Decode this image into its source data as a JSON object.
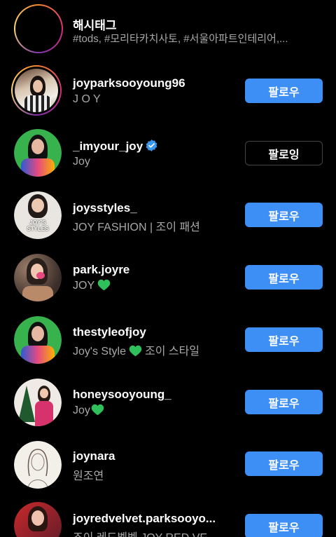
{
  "hashtag": {
    "title": "해시태그",
    "subtitle": "#tods, #모리타카치사토, #서울아파트인테리어,..."
  },
  "accounts": [
    {
      "username": "joyparksooyoung96",
      "subtitle": "J O Y",
      "button": "팔로우",
      "verified": false
    },
    {
      "username": "_imyour_joy",
      "subtitle": "Joy",
      "button": "팔로잉",
      "verified": true
    },
    {
      "username": "joysstyles_",
      "subtitle": "JOY FASHION | 조이 패션",
      "button": "팔로우",
      "verified": false,
      "avatar_text": "JOY'S STYLES"
    },
    {
      "username": "park.joyre",
      "subtitle": "JOY",
      "button": "팔로우",
      "verified": false,
      "heart": true
    },
    {
      "username": "thestyleofjoy",
      "subtitle_a": "Joy's Style",
      "subtitle_b": "조이 스타일",
      "button": "팔로우",
      "verified": false
    },
    {
      "username": "honeysooyoung_",
      "subtitle": "Joy",
      "button": "팔로우",
      "verified": false,
      "heart": true
    },
    {
      "username": "joynara",
      "subtitle": "원조연",
      "button": "팔로우",
      "verified": false
    },
    {
      "username": "joyredvelvet.parksooyo...",
      "subtitle": "조이 레드벨벳 JOY RED VE",
      "button": "팔로우",
      "verified": false
    }
  ],
  "colors": {
    "follow_button": "#3d8ff5",
    "verified_badge": "#3897f0",
    "green_heart": "#2ec05a",
    "subtext": "#a8a8a8"
  }
}
